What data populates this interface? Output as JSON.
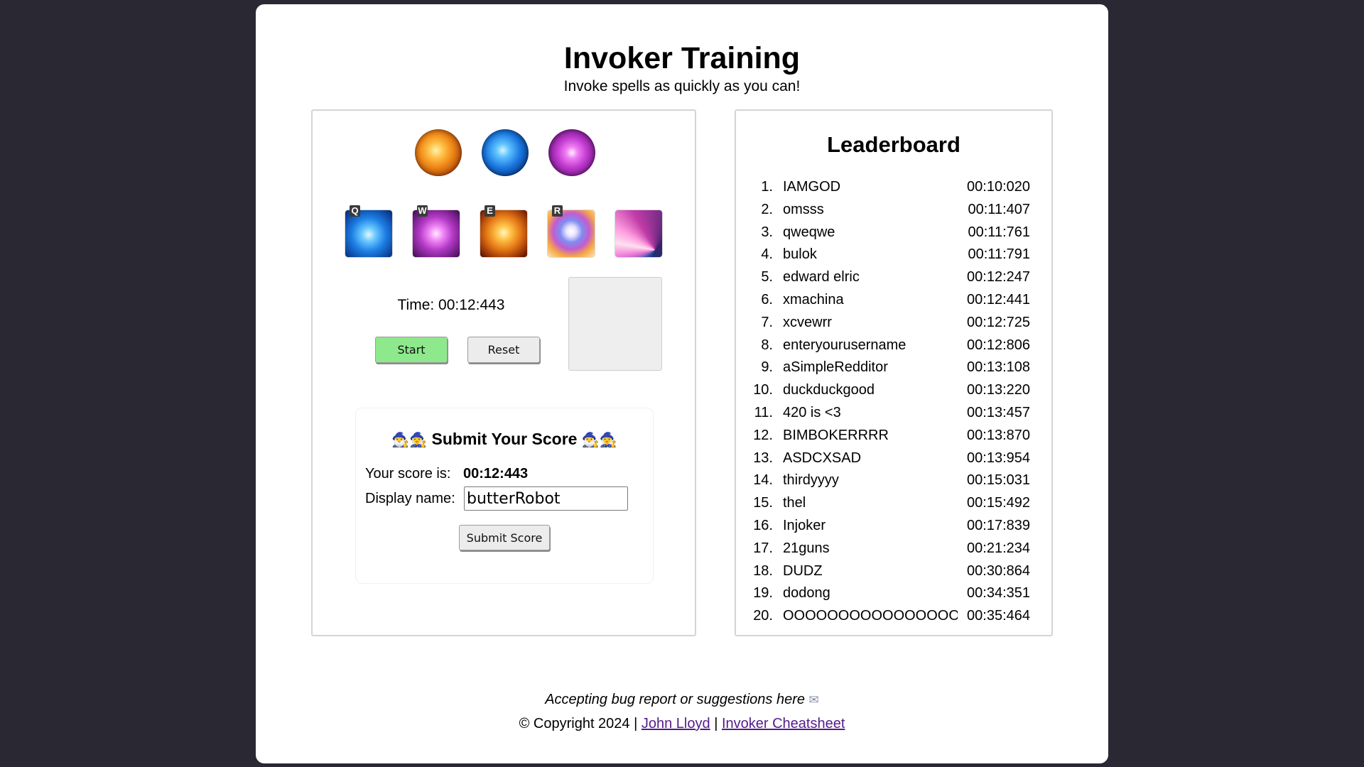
{
  "header": {
    "title": "Invoker Training",
    "subtitle": "Invoke spells as quickly as you can!"
  },
  "game": {
    "orbs": [
      "exort-orb",
      "quas-orb",
      "wex-orb"
    ],
    "abilities": [
      {
        "name": "quas-ability",
        "hotkey": "Q"
      },
      {
        "name": "wex-ability",
        "hotkey": "W"
      },
      {
        "name": "exort-ability",
        "hotkey": "E"
      },
      {
        "name": "invoke-ability",
        "hotkey": "R"
      },
      {
        "name": "invoked-spell-slot",
        "hotkey": ""
      }
    ],
    "timer": "Time: 00:12:443",
    "start_label": "Start",
    "reset_label": "Reset"
  },
  "submit": {
    "title": "Submit Your Score",
    "emoji": "🧙‍♂️🧙‍♀️",
    "score_label": "Your score is:",
    "score_value": "00:12:443",
    "name_label": "Display name:",
    "name_value": "butterRobot",
    "button_label": "Submit Score"
  },
  "leaderboard": {
    "title": "Leaderboard",
    "entries": [
      {
        "rank": "1.",
        "name": "IAMGOD",
        "time": "00:10:020"
      },
      {
        "rank": "2.",
        "name": "omsss",
        "time": "00:11:407"
      },
      {
        "rank": "3.",
        "name": "qweqwe",
        "time": "00:11:761"
      },
      {
        "rank": "4.",
        "name": "bulok",
        "time": "00:11:791"
      },
      {
        "rank": "5.",
        "name": "edward elric",
        "time": "00:12:247"
      },
      {
        "rank": "6.",
        "name": "xmachina",
        "time": "00:12:441"
      },
      {
        "rank": "7.",
        "name": "xcvewrr",
        "time": "00:12:725"
      },
      {
        "rank": "8.",
        "name": "enteryourusername",
        "time": "00:12:806"
      },
      {
        "rank": "9.",
        "name": "aSimpleRedditor",
        "time": "00:13:108"
      },
      {
        "rank": "10.",
        "name": "duckduckgood",
        "time": "00:13:220"
      },
      {
        "rank": "11.",
        "name": "420 is <3",
        "time": "00:13:457"
      },
      {
        "rank": "12.",
        "name": "BIMBOKERRRR",
        "time": "00:13:870"
      },
      {
        "rank": "13.",
        "name": "ASDCXSAD",
        "time": "00:13:954"
      },
      {
        "rank": "14.",
        "name": "thirdyyyy",
        "time": "00:15:031"
      },
      {
        "rank": "15.",
        "name": "thel",
        "time": "00:15:492"
      },
      {
        "rank": "16.",
        "name": "Injoker",
        "time": "00:17:839"
      },
      {
        "rank": "17.",
        "name": "21guns",
        "time": "00:21:234"
      },
      {
        "rank": "18.",
        "name": "DUDZ",
        "time": "00:30:864"
      },
      {
        "rank": "19.",
        "name": "dodong",
        "time": "00:34:351"
      },
      {
        "rank": "20.",
        "name": "OOOOOOOOOOOOOOOO",
        "time": "00:35:464"
      }
    ]
  },
  "footer": {
    "note": "Accepting bug report or suggestions here",
    "note_icon": "envelope-icon",
    "copyright": "© Copyright 2024 |",
    "separator": "|",
    "author_link": "John Lloyd",
    "cheatsheet_link": "Invoker Cheatsheet"
  },
  "colors": {
    "background": "#2a2833",
    "start_button": "#8ee88c",
    "link": "#551a8b"
  }
}
